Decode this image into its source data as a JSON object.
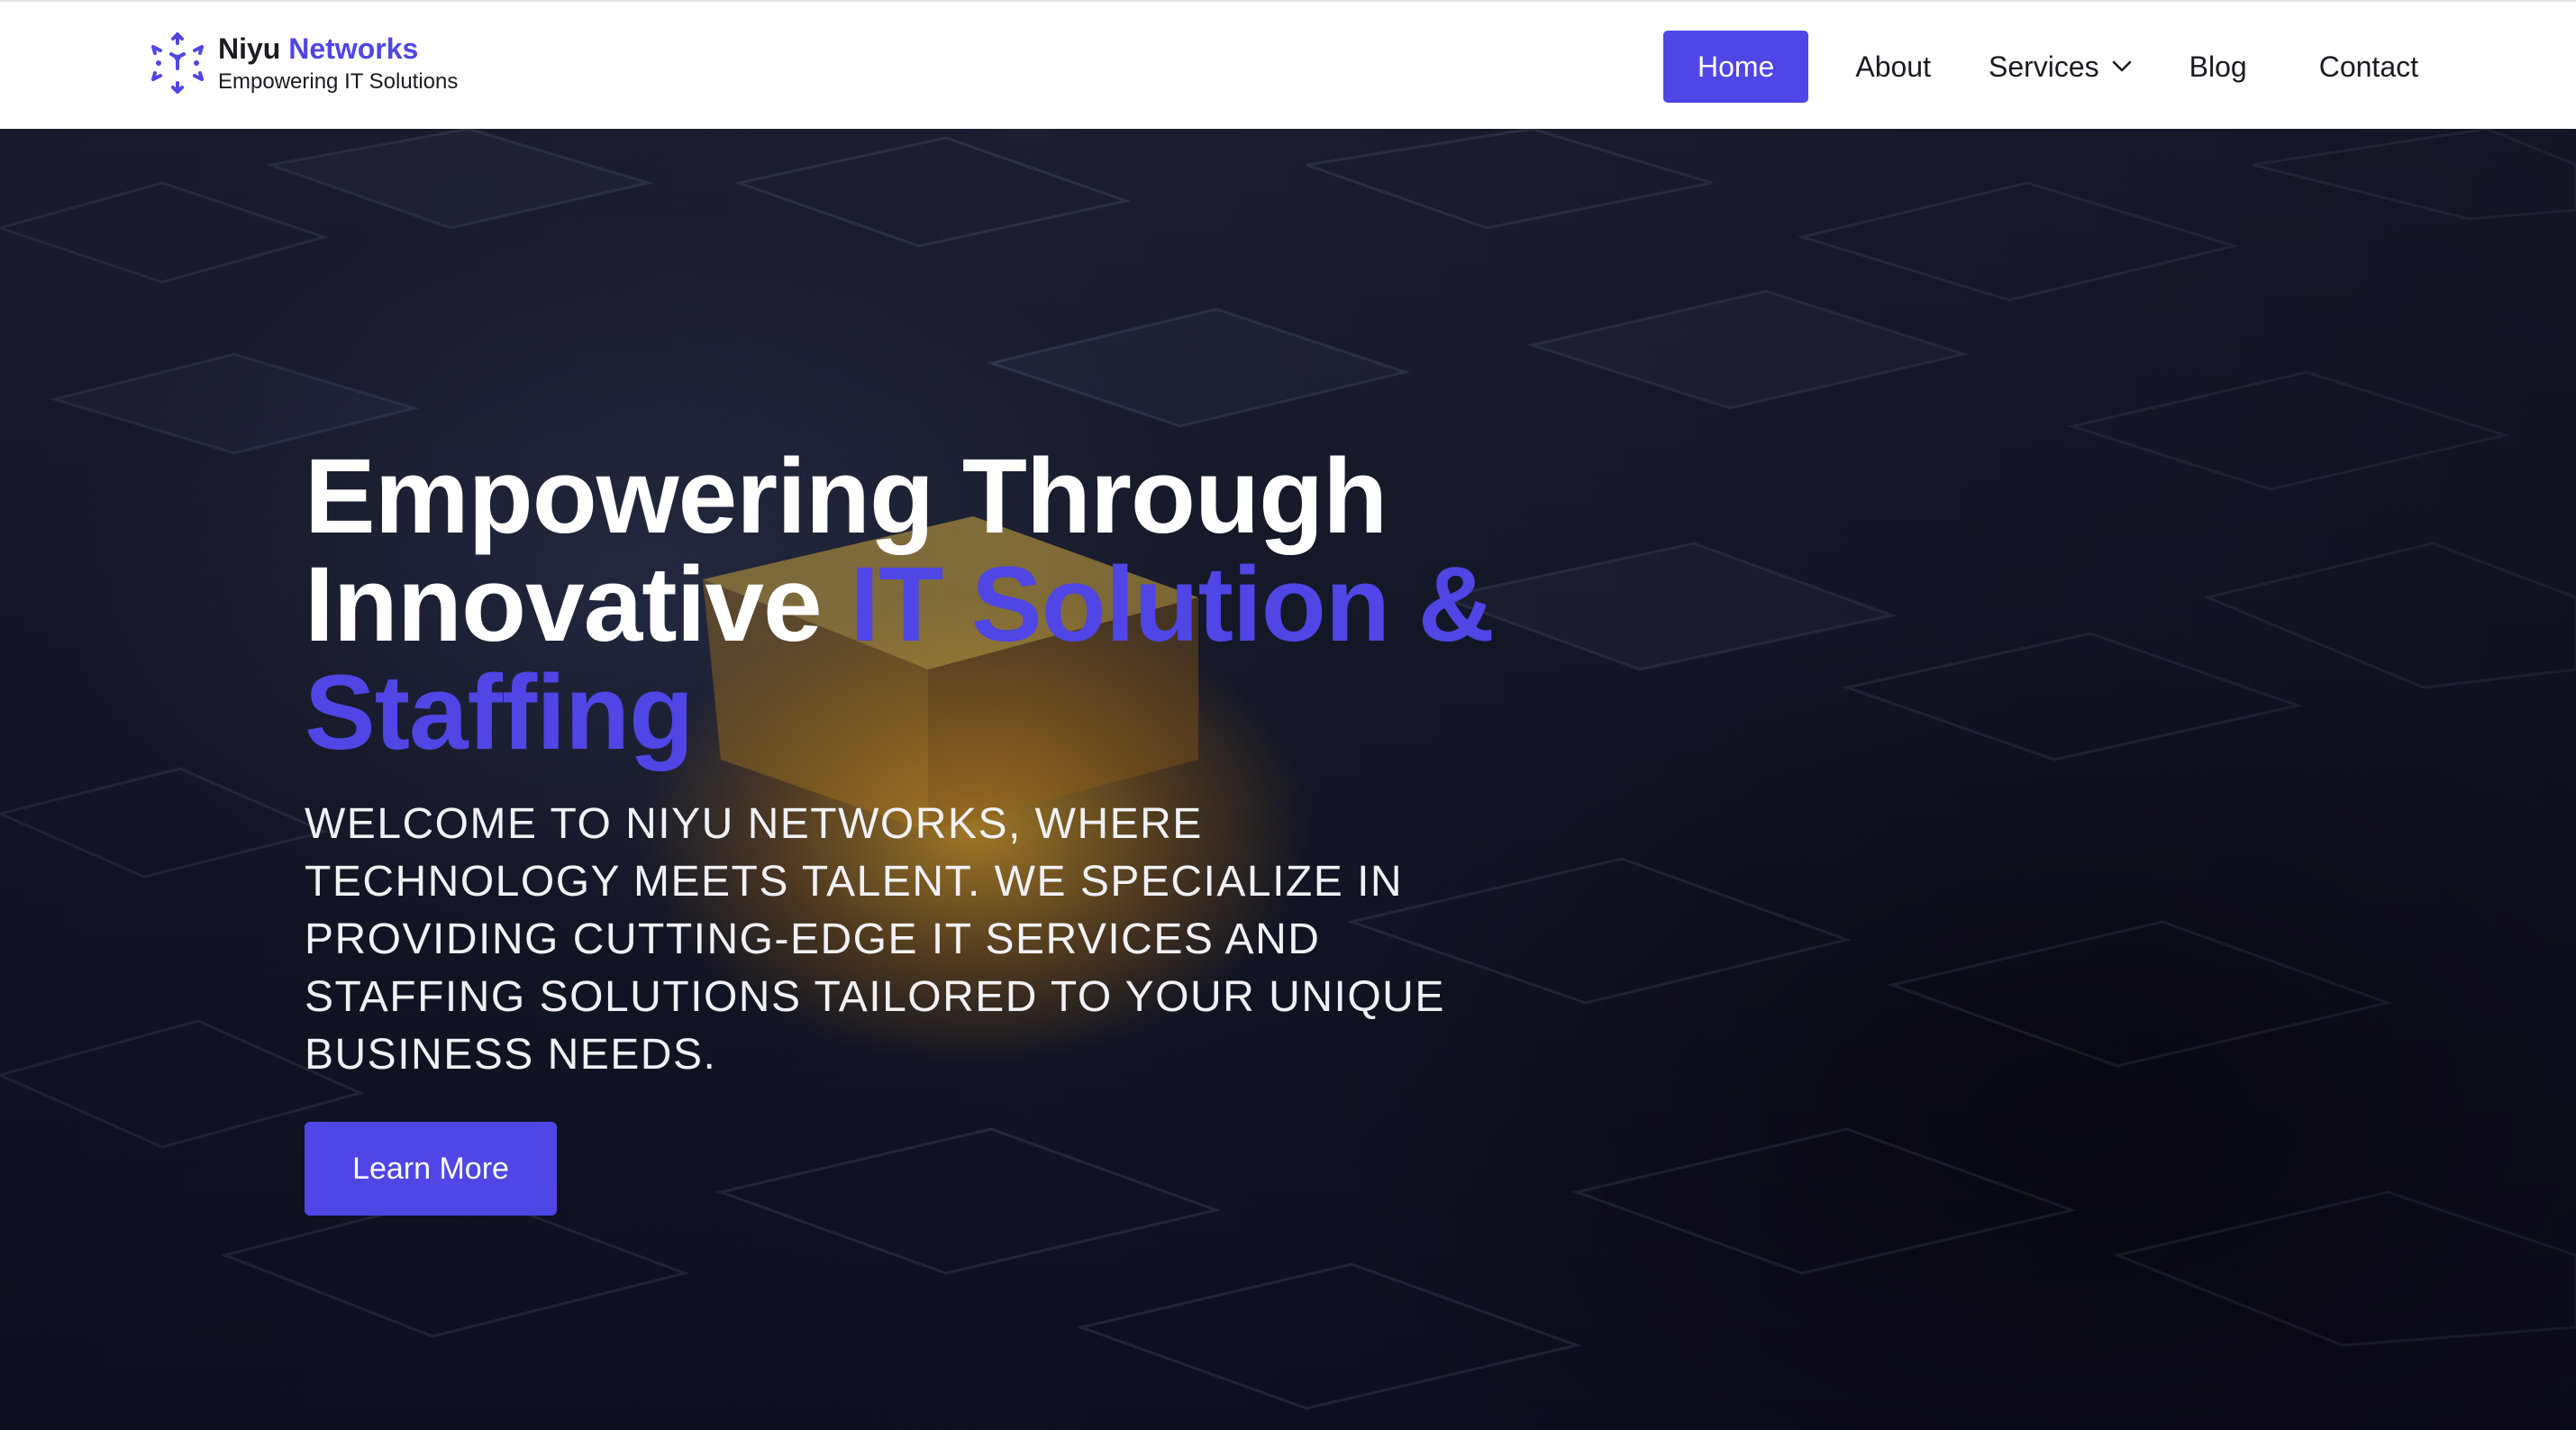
{
  "brand": {
    "name_primary": "Niyu",
    "name_accent": "Networks",
    "tagline": "Empowering IT Solutions",
    "logo_icon": "network-nodes-icon",
    "accent_color": "#4f46e5"
  },
  "nav": {
    "items": [
      {
        "label": "Home",
        "active": true
      },
      {
        "label": "About"
      },
      {
        "label": "Services",
        "has_dropdown": true,
        "icon": "chevron-down-icon"
      },
      {
        "label": "Blog"
      },
      {
        "label": "Contact"
      }
    ]
  },
  "hero": {
    "title_line1": "Empowering Through",
    "title_line2_plain": "Innovative ",
    "title_line2_accent": "IT Solution &",
    "title_line3_accent": "Staffing",
    "description": "WELCOME TO NIYU NETWORKS, WHERE TECHNOLOGY MEETS TALENT. WE SPECIALIZE IN PROVIDING CUTTING-EDGE IT SERVICES AND STAFFING SOLUTIONS TAILORED TO YOUR UNIQUE BUSINESS NEEDS.",
    "cta_label": "Learn More",
    "background_image": "dark-3d-cubes-with-glowing-yellow-cube"
  }
}
